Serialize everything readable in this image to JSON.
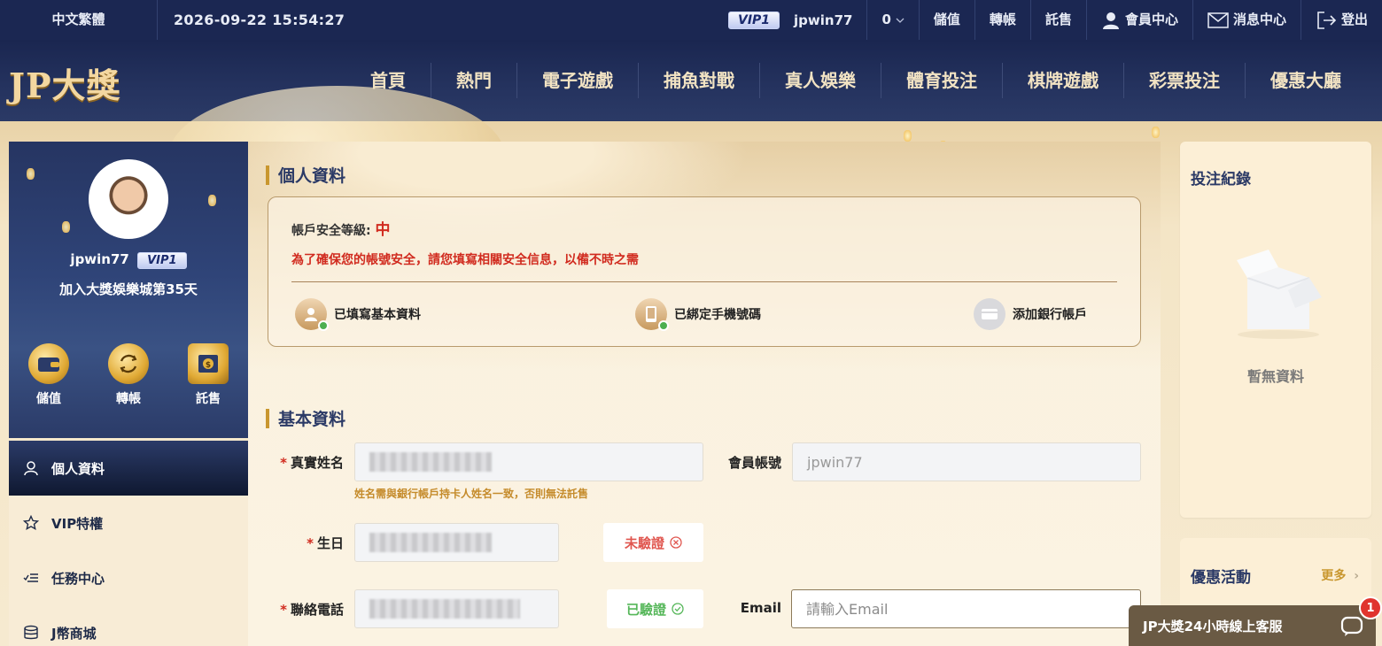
{
  "topbar": {
    "language": "中文繁體",
    "datetime": "2026-09-22 15:54:27",
    "vip": "VIP1",
    "username": "jpwin77",
    "balance": "0",
    "deposit": "儲值",
    "transfer": "轉帳",
    "sell": "託售",
    "member_center": "會員中心",
    "message_center": "消息中心",
    "logout": "登出"
  },
  "brand": {
    "logo_text": "JP大獎"
  },
  "nav": [
    "首頁",
    "熱門",
    "電子遊戲",
    "捕魚對戰",
    "真人娛樂",
    "體育投注",
    "棋牌遊戲",
    "彩票投注",
    "優惠大廳"
  ],
  "profile": {
    "username": "jpwin77",
    "vip": "VIP1",
    "joined": "加入大獎娛樂城第35天",
    "actions": [
      {
        "label": "儲值",
        "icon": "wallet-icon"
      },
      {
        "label": "轉帳",
        "icon": "transfer-icon"
      },
      {
        "label": "託售",
        "icon": "atm-icon"
      }
    ]
  },
  "menu": [
    {
      "label": "個人資料",
      "icon": "user-icon",
      "active": true
    },
    {
      "label": "VIP特權",
      "icon": "star-icon",
      "active": false
    },
    {
      "label": "任務中心",
      "icon": "task-list-icon",
      "active": false
    },
    {
      "label": "J幣商城",
      "icon": "coin-stack-icon",
      "active": false
    }
  ],
  "main": {
    "title": "個人資料",
    "security": {
      "level_label": "帳戶安全等級:",
      "level_value": "中",
      "warning": "為了確保您的帳號安全，請您填寫相關安全信息，以備不時之需",
      "steps": [
        {
          "label": "已填寫基本資料",
          "icon": "user-check-icon",
          "done": true
        },
        {
          "label": "已綁定手機號碼",
          "icon": "phone-check-icon",
          "done": true
        },
        {
          "label": "添加銀行帳戶",
          "icon": "bank-card-icon",
          "done": false
        }
      ]
    },
    "basic": {
      "title": "基本資料",
      "real_name_label": "真實姓名",
      "name_hint": "姓名需與銀行帳戶持卡人姓名一致，否則無法託售",
      "account_label": "會員帳號",
      "account_value": "jpwin77",
      "birthday_label": "生日",
      "birthday_status": "未驗證",
      "phone_label": "聯絡電話",
      "phone_status": "已驗證",
      "email_label": "Email",
      "email_placeholder": "請輸入Email"
    }
  },
  "right": {
    "bet_title": "投注紀錄",
    "empty": "暫無資料",
    "promo_title": "優惠活動",
    "promo_more": "更多"
  },
  "chat": {
    "label": "JP大獎24小時線上客服",
    "badge": "1"
  },
  "colors": {
    "navy": "#1b2752",
    "gold": "#c9972f",
    "danger": "#d12b1f",
    "success": "#56b75a"
  }
}
